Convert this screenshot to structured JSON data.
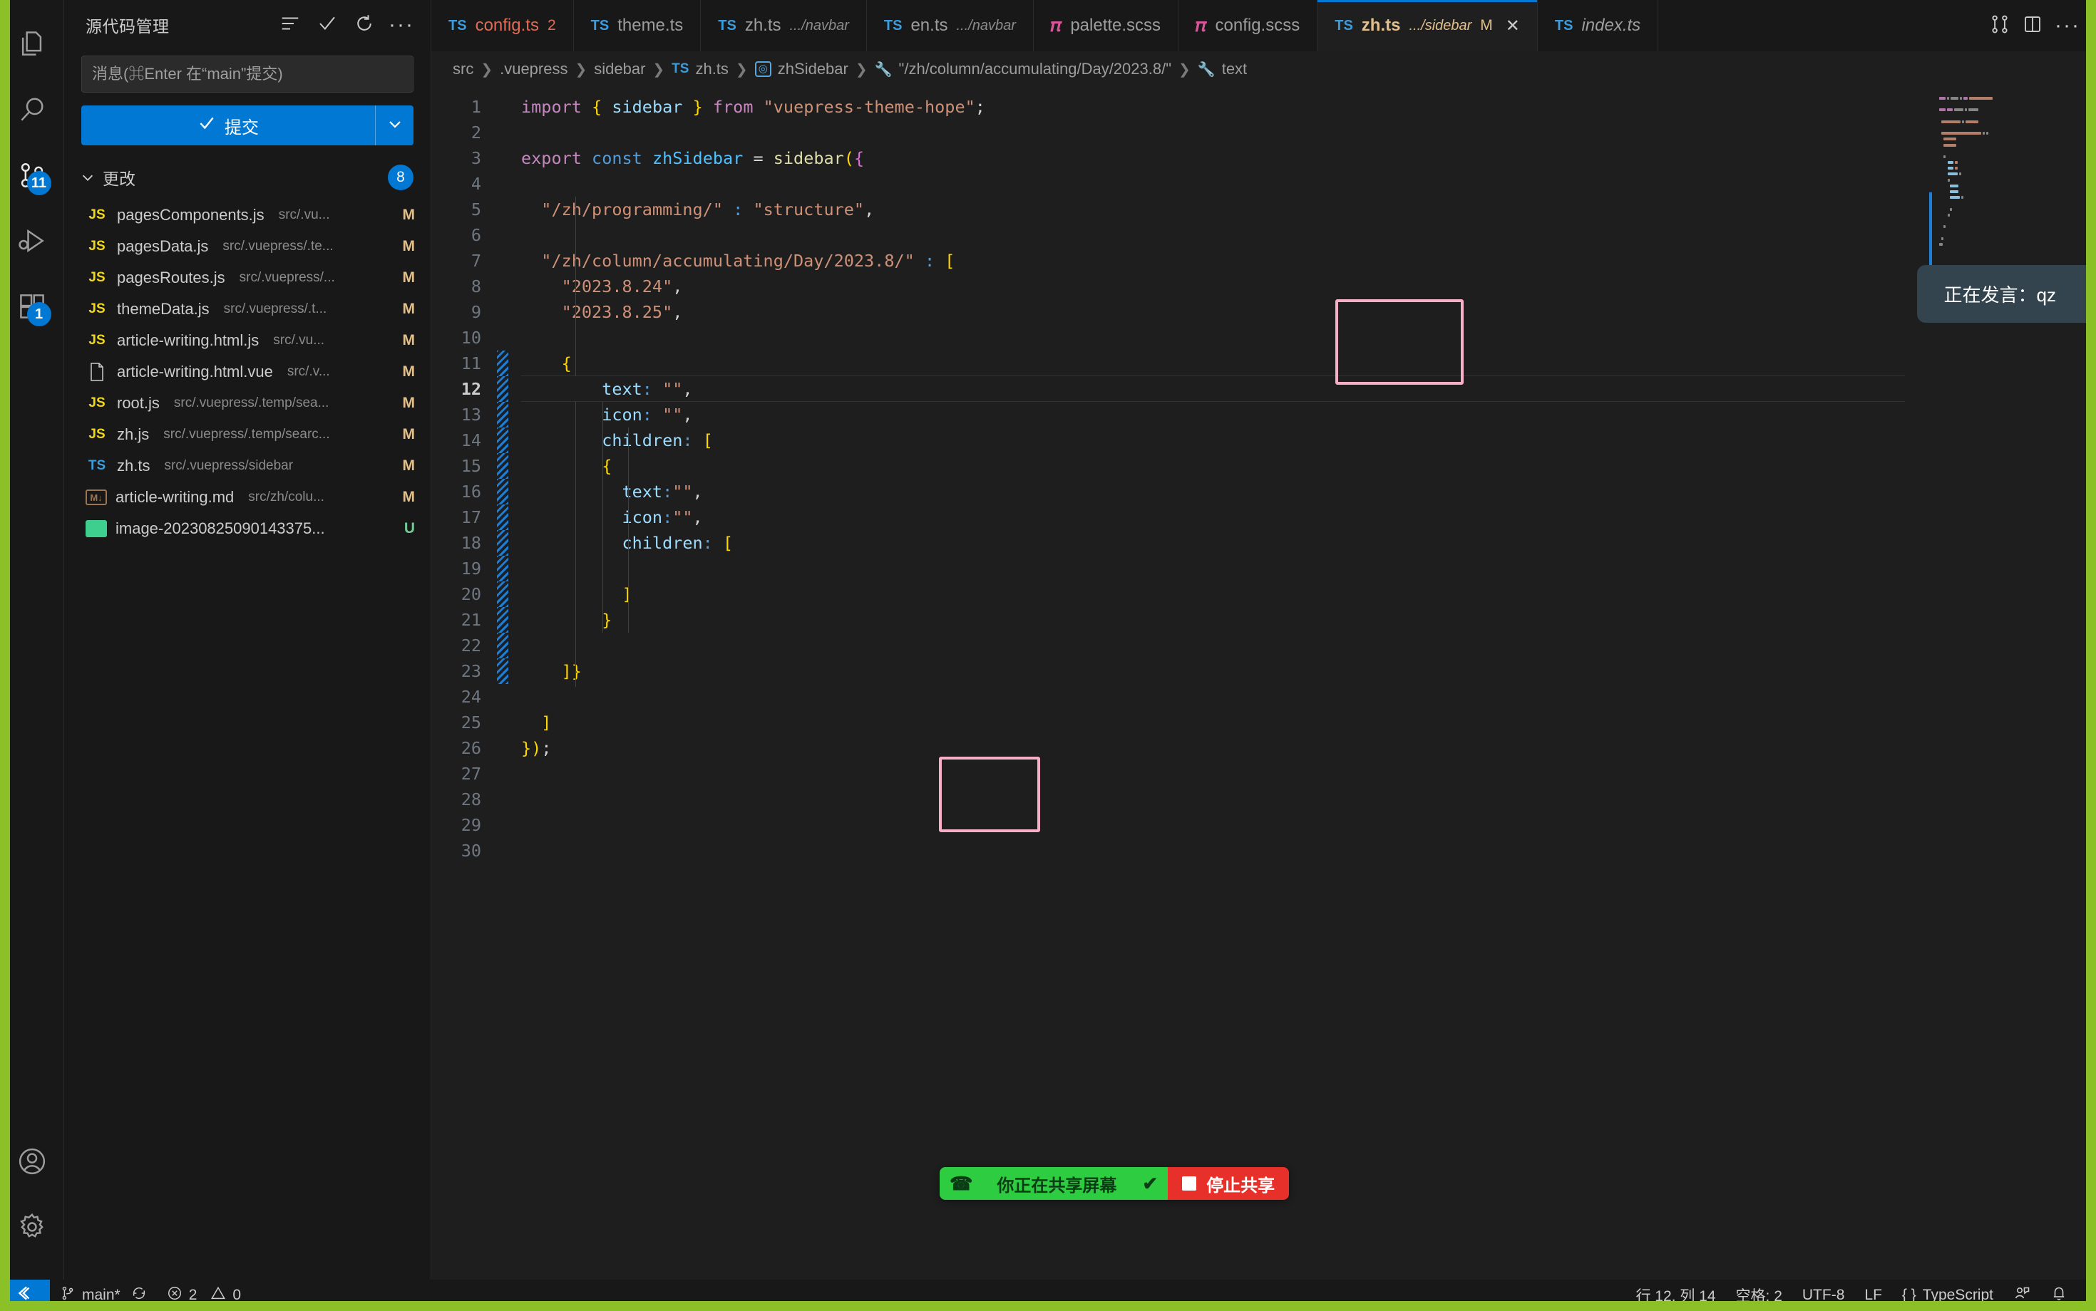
{
  "activity_bar": {
    "items": [
      {
        "name": "explorer",
        "icon": "files-icon",
        "badge": null,
        "active": false
      },
      {
        "name": "search",
        "icon": "search-icon",
        "badge": null,
        "active": false
      },
      {
        "name": "source-control",
        "icon": "source-control-icon",
        "badge": "11",
        "active": true
      },
      {
        "name": "run-and-debug",
        "icon": "run-debug-icon",
        "badge": null,
        "active": false
      },
      {
        "name": "extensions",
        "icon": "extensions-icon",
        "badge": "1",
        "active": false
      }
    ],
    "bottom_items": [
      {
        "name": "accounts",
        "icon": "account-icon"
      },
      {
        "name": "settings",
        "icon": "gear-icon"
      }
    ]
  },
  "sidebar": {
    "title": "源代码管理",
    "actions": [
      {
        "name": "view-as-list",
        "icon": "list-icon"
      },
      {
        "name": "commit-check",
        "icon": "check-icon"
      },
      {
        "name": "refresh",
        "icon": "refresh-icon"
      },
      {
        "name": "more-actions",
        "icon": "ellipsis-icon"
      }
    ],
    "commit_placeholder": "消息(⌘Enter 在“main”提交)",
    "commit_value": "",
    "commit_button": "提交",
    "changes_label": "更改",
    "changes_count": "8",
    "files": [
      {
        "icon": "js",
        "name": "pagesComponents.js",
        "path": "src/.vu...",
        "status": "M"
      },
      {
        "icon": "js",
        "name": "pagesData.js",
        "path": "src/.vuepress/.te...",
        "status": "M"
      },
      {
        "icon": "js",
        "name": "pagesRoutes.js",
        "path": "src/.vuepress/...",
        "status": "M"
      },
      {
        "icon": "js",
        "name": "themeData.js",
        "path": "src/.vuepress/.t...",
        "status": "M"
      },
      {
        "icon": "js",
        "name": "article-writing.html.js",
        "path": "src/.vu...",
        "status": "M"
      },
      {
        "icon": "vue",
        "name": "article-writing.html.vue",
        "path": "src/.v...",
        "status": "M"
      },
      {
        "icon": "js",
        "name": "root.js",
        "path": "src/.vuepress/.temp/sea...",
        "status": "M"
      },
      {
        "icon": "js",
        "name": "zh.js",
        "path": "src/.vuepress/.temp/searc...",
        "status": "M"
      },
      {
        "icon": "ts",
        "name": "zh.ts",
        "path": "src/.vuepress/sidebar",
        "status": "M"
      },
      {
        "icon": "md",
        "name": "article-writing.md",
        "path": "src/zh/colu...",
        "status": "M"
      },
      {
        "icon": "img",
        "name": "image-20230825090143375...",
        "path": "",
        "status": "U"
      }
    ]
  },
  "tabs": [
    {
      "icon": "ts",
      "label": "config.ts",
      "sub": "",
      "dirty": true,
      "count": "2",
      "active": false,
      "italic": false
    },
    {
      "icon": "ts",
      "label": "theme.ts",
      "sub": "",
      "dirty": false,
      "count": "",
      "active": false,
      "italic": false
    },
    {
      "icon": "ts",
      "label": "zh.ts",
      "sub": ".../navbar",
      "dirty": false,
      "count": "",
      "active": false,
      "italic": false
    },
    {
      "icon": "ts",
      "label": "en.ts",
      "sub": ".../navbar",
      "dirty": false,
      "count": "",
      "active": false,
      "italic": false
    },
    {
      "icon": "scss",
      "label": "palette.scss",
      "sub": "",
      "dirty": false,
      "count": "",
      "active": false,
      "italic": false
    },
    {
      "icon": "scss",
      "label": "config.scss",
      "sub": "",
      "dirty": false,
      "count": "",
      "active": false,
      "italic": false
    },
    {
      "icon": "ts",
      "label": "zh.ts",
      "sub": ".../sidebar",
      "dirty": false,
      "count": "",
      "active": true,
      "modified": "M",
      "italic": false
    },
    {
      "icon": "ts",
      "label": "index.ts",
      "sub": "",
      "dirty": false,
      "count": "",
      "active": false,
      "italic": true
    }
  ],
  "tab_actions": [
    {
      "name": "split-compare",
      "icon": "compare-icon"
    },
    {
      "name": "split-editor",
      "icon": "split-editor-icon"
    },
    {
      "name": "more-editor-actions",
      "icon": "ellipsis-icon"
    }
  ],
  "breadcrumbs": [
    {
      "icon": "",
      "label": "src"
    },
    {
      "icon": "",
      "label": ".vuepress"
    },
    {
      "icon": "",
      "label": "sidebar"
    },
    {
      "icon": "ts",
      "label": "zh.ts"
    },
    {
      "icon": "symbol-variable",
      "label": "zhSidebar"
    },
    {
      "icon": "wrench",
      "label": "\"/zh/column/accumulating/Day/2023.8/\""
    },
    {
      "icon": "wrench",
      "label": "text"
    }
  ],
  "code": {
    "language": "TypeScript",
    "total_lines": 30,
    "current_line": 12,
    "lines": [
      {
        "n": 1,
        "modified": false,
        "text": "import { sidebar } from \"vuepress-theme-hope\";"
      },
      {
        "n": 2,
        "modified": false,
        "text": ""
      },
      {
        "n": 3,
        "modified": false,
        "text": "export const zhSidebar = sidebar({"
      },
      {
        "n": 4,
        "modified": false,
        "text": ""
      },
      {
        "n": 5,
        "modified": false,
        "text": "  \"/zh/programming/\" : \"structure\","
      },
      {
        "n": 6,
        "modified": false,
        "text": ""
      },
      {
        "n": 7,
        "modified": false,
        "text": "  \"/zh/column/accumulating/Day/2023.8/\" : ["
      },
      {
        "n": 8,
        "modified": false,
        "text": "    \"2023.8.24\","
      },
      {
        "n": 9,
        "modified": false,
        "text": "    \"2023.8.25\","
      },
      {
        "n": 10,
        "modified": false,
        "text": ""
      },
      {
        "n": 11,
        "modified": true,
        "text": "    {"
      },
      {
        "n": 12,
        "modified": true,
        "text": "        text: \"\","
      },
      {
        "n": 13,
        "modified": true,
        "text": "        icon: \"\","
      },
      {
        "n": 14,
        "modified": true,
        "text": "        children: ["
      },
      {
        "n": 15,
        "modified": true,
        "text": "        {"
      },
      {
        "n": 16,
        "modified": true,
        "text": "          text:\"\","
      },
      {
        "n": 17,
        "modified": true,
        "text": "          icon:\"\","
      },
      {
        "n": 18,
        "modified": true,
        "text": "          children: ["
      },
      {
        "n": 19,
        "modified": true,
        "text": ""
      },
      {
        "n": 20,
        "modified": true,
        "text": "          ]"
      },
      {
        "n": 21,
        "modified": true,
        "text": "        }"
      },
      {
        "n": 22,
        "modified": true,
        "text": ""
      },
      {
        "n": 23,
        "modified": true,
        "text": "    ]}"
      },
      {
        "n": 24,
        "modified": false,
        "text": ""
      },
      {
        "n": 25,
        "modified": false,
        "text": "  ]"
      },
      {
        "n": 26,
        "modified": false,
        "text": "});"
      },
      {
        "n": 27,
        "modified": false,
        "text": ""
      },
      {
        "n": 28,
        "modified": false,
        "text": ""
      },
      {
        "n": 29,
        "modified": false,
        "text": ""
      },
      {
        "n": 30,
        "modified": false,
        "text": ""
      }
    ]
  },
  "statusbar": {
    "remote_icon": "remote-window-icon",
    "branch": "main*",
    "sync_icon": "sync-icon",
    "errors": "2",
    "warnings": "0",
    "cursor": "行 12, 列 14",
    "spaces": "空格: 2",
    "encoding": "UTF-8",
    "eol": "LF",
    "language": "TypeScript",
    "feedback_icon": "feedback-icon",
    "bell_icon": "bell-icon"
  },
  "overlays": {
    "speaking_toast": "正在发言：qz",
    "share_message": "你正在共享屏幕",
    "stop_share": "停止共享",
    "colors": {
      "share_green": "#2ecc40",
      "share_red": "#e8302a",
      "border_green": "#8bc127",
      "accent_blue": "#0078d4",
      "highlight_pink": "#f7aec8"
    }
  }
}
